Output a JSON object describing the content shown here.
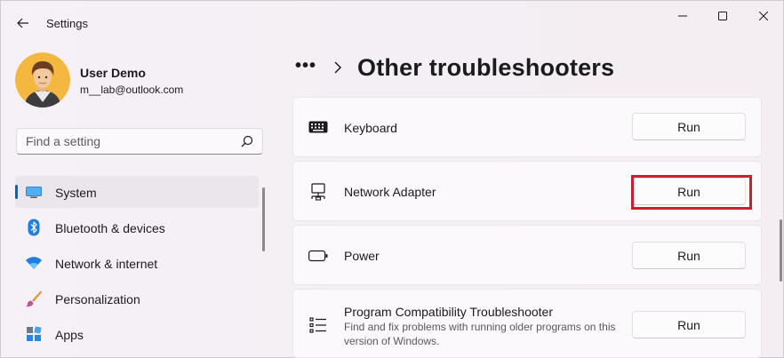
{
  "window": {
    "title": "Settings"
  },
  "user": {
    "name": "User Demo",
    "email": "m__lab@outlook.com"
  },
  "search": {
    "placeholder": "Find a setting",
    "value": ""
  },
  "sidebar": {
    "items": [
      {
        "label": "System",
        "icon": "system-icon",
        "selected": true
      },
      {
        "label": "Bluetooth & devices",
        "icon": "bluetooth-icon",
        "selected": false
      },
      {
        "label": "Network & internet",
        "icon": "wifi-icon",
        "selected": false
      },
      {
        "label": "Personalization",
        "icon": "brush-icon",
        "selected": false
      },
      {
        "label": "Apps",
        "icon": "apps-icon",
        "selected": false
      }
    ]
  },
  "breadcrumb": {
    "more": "•••",
    "title": "Other troubleshooters"
  },
  "troubleshooters": [
    {
      "title": "Keyboard",
      "icon": "keyboard-icon",
      "button": "Run"
    },
    {
      "title": "Network Adapter",
      "icon": "network-adapter-icon",
      "button": "Run",
      "highlighted": true
    },
    {
      "title": "Power",
      "icon": "battery-icon",
      "button": "Run"
    },
    {
      "title": "Program Compatibility Troubleshooter",
      "description": "Find and fix problems with running older programs on this version of Windows.",
      "icon": "list-icon",
      "button": "Run"
    }
  ],
  "colors": {
    "accent": "#0067c0",
    "highlight": "#c8202d",
    "background": "#f3eff3",
    "card": "#fbf9fb"
  }
}
